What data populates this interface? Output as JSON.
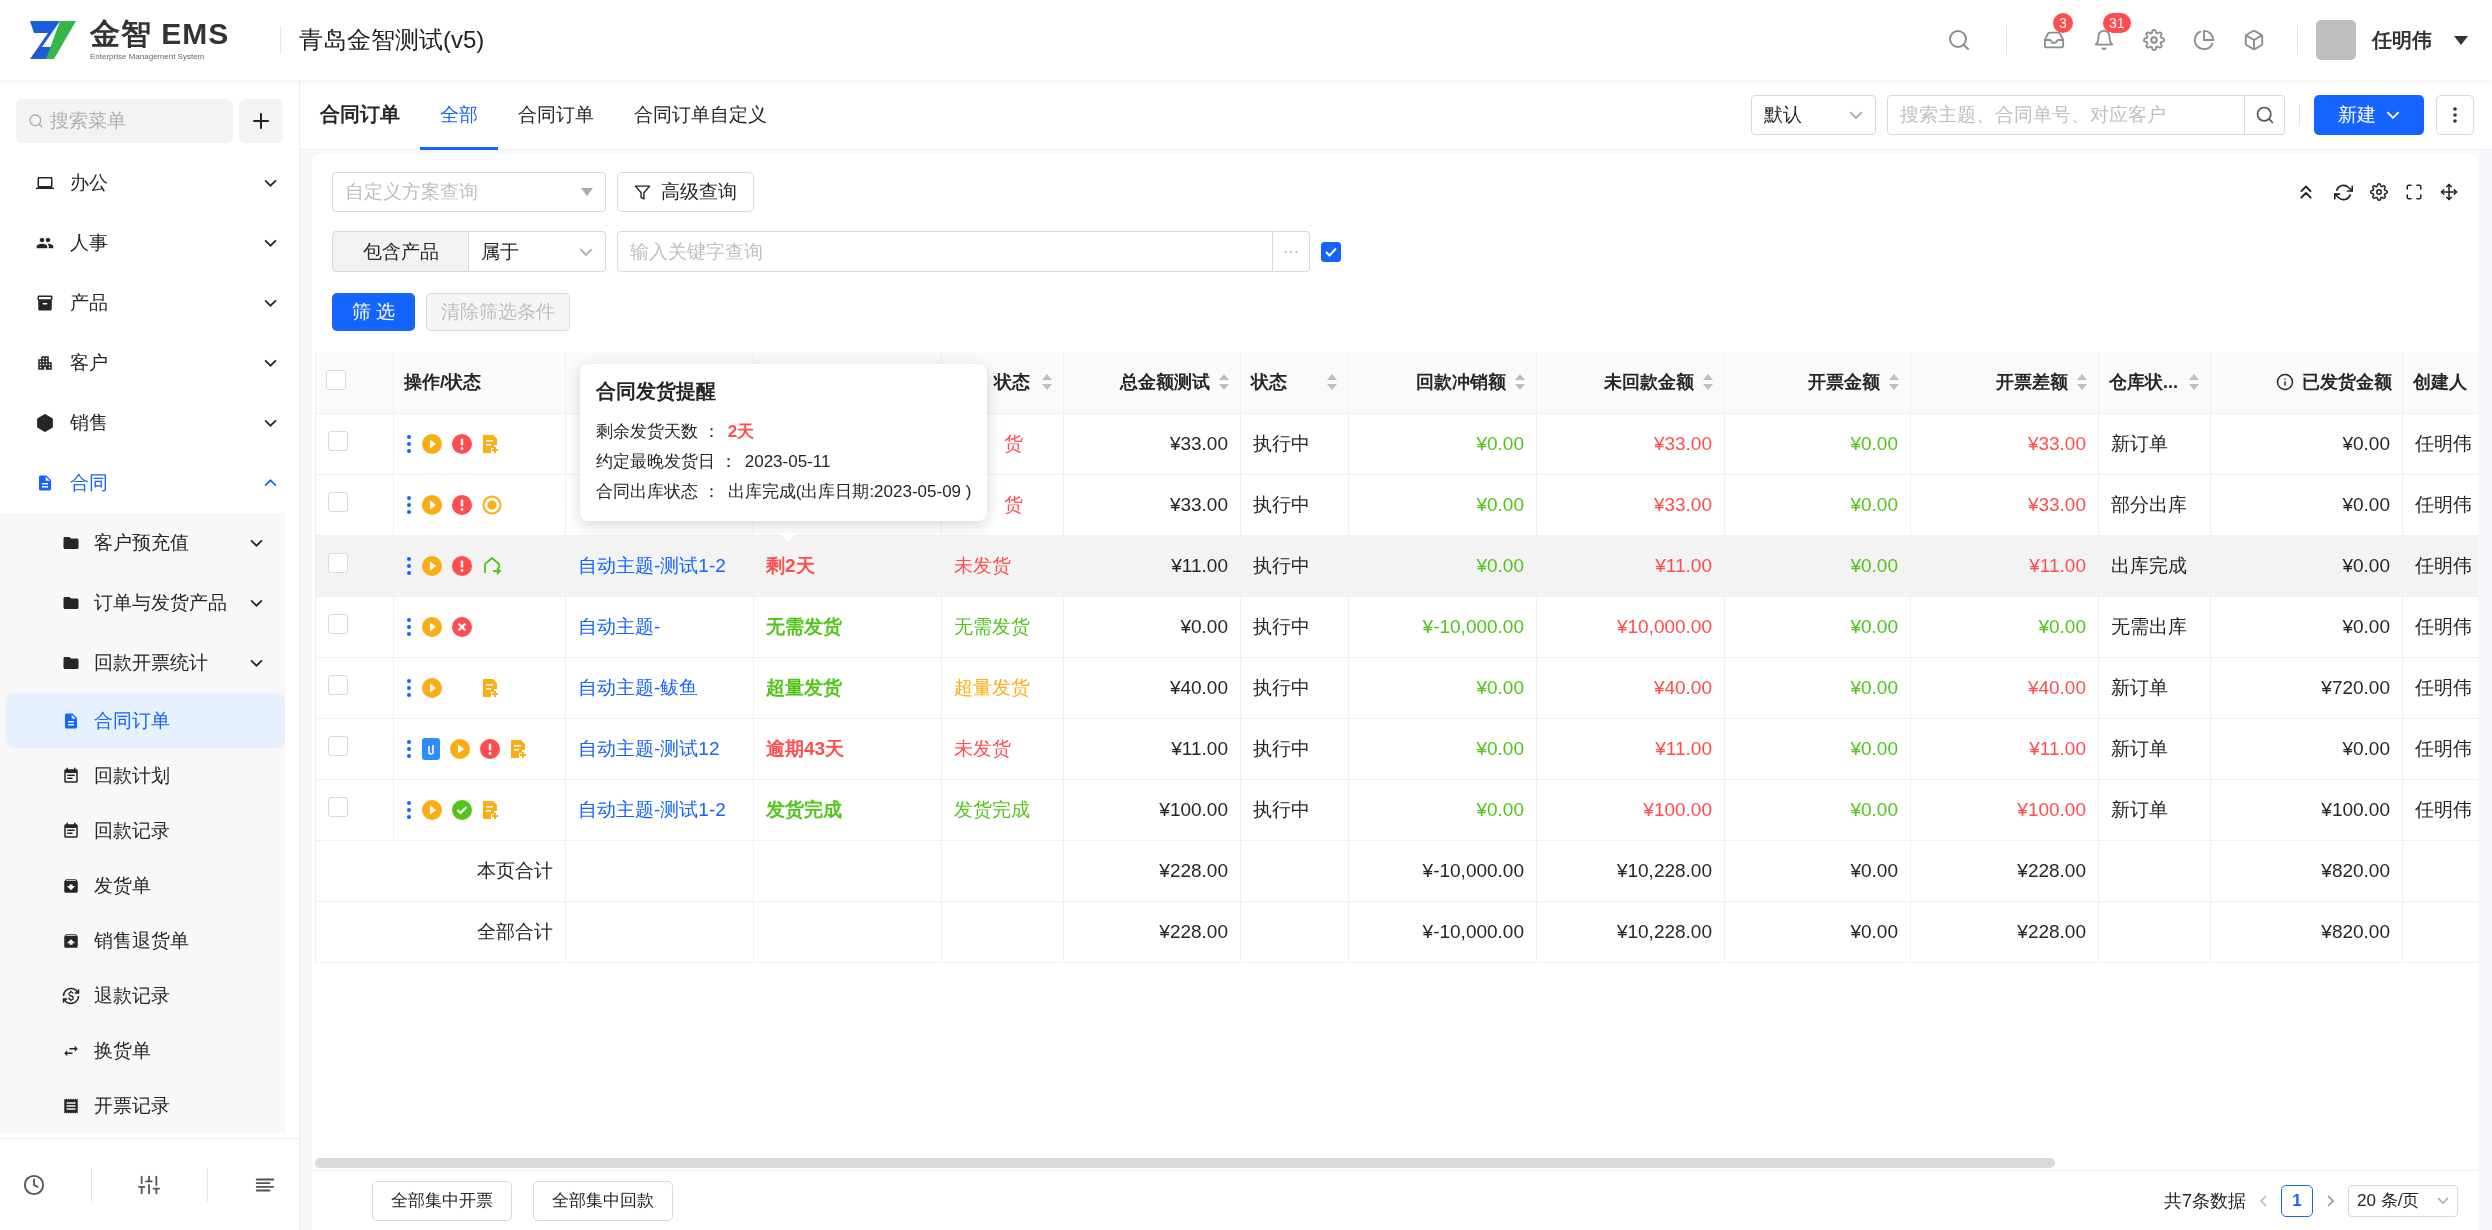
{
  "header": {
    "logo_text": "金智 EMS",
    "logo_subtitle": "Enterprise Management System",
    "company": "青岛金智测试(v5)",
    "notifications": [
      {
        "kind": "inbox",
        "badge": "3"
      },
      {
        "kind": "bell",
        "badge": "31"
      },
      {
        "kind": "settings"
      },
      {
        "kind": "chart"
      },
      {
        "kind": "cube"
      }
    ],
    "user": "任明伟"
  },
  "sidebar": {
    "search_placeholder": "搜索菜单",
    "items": [
      {
        "label": "办公",
        "expanded": false,
        "selected": false
      },
      {
        "label": "人事",
        "expanded": false,
        "selected": false
      },
      {
        "label": "产品",
        "expanded": false,
        "selected": false
      },
      {
        "label": "客户",
        "expanded": false,
        "selected": false
      },
      {
        "label": "销售",
        "expanded": false,
        "selected": false
      },
      {
        "label": "合同",
        "expanded": true,
        "selected": true,
        "children": [
          {
            "label": "客户预充值",
            "kind": "folder",
            "expanded": false,
            "selected": false
          },
          {
            "label": "订单与发货产品",
            "kind": "folder",
            "expanded": false,
            "selected": false
          },
          {
            "label": "回款开票统计",
            "kind": "folder",
            "expanded": false,
            "selected": false
          },
          {
            "label": "合同订单",
            "kind": "page",
            "selected": true
          },
          {
            "label": "回款计划",
            "kind": "page",
            "selected": false
          },
          {
            "label": "回款记录",
            "kind": "page",
            "selected": false
          },
          {
            "label": "发货单",
            "kind": "page",
            "selected": false
          },
          {
            "label": "销售退货单",
            "kind": "page",
            "selected": false
          },
          {
            "label": "退款记录",
            "kind": "page",
            "selected": false
          },
          {
            "label": "换货单",
            "kind": "page",
            "selected": false
          },
          {
            "label": "开票记录",
            "kind": "page",
            "selected": false
          }
        ]
      }
    ]
  },
  "tabbar": {
    "title": "合同订单",
    "tabs": [
      {
        "label": "全部",
        "selected": true
      },
      {
        "label": "合同订单",
        "selected": false
      },
      {
        "label": "合同订单自定义",
        "selected": false
      }
    ],
    "view_select": "默认",
    "search_placeholder": "搜索主题、合同单号、对应客户",
    "new_button": "新建"
  },
  "filter": {
    "scheme_placeholder": "自定义方案查询",
    "advanced_button": "高级查询",
    "field_label": "包含产品",
    "operator": "属于",
    "keyword_placeholder": "输入关键字查询",
    "more_button": "···",
    "include_checked": true,
    "apply_button": "筛 选",
    "clear_button": {
      "label": "清除筛选条件",
      "disabled": true
    }
  },
  "table": {
    "columns": [
      {
        "kind": "check",
        "checked": false
      },
      {
        "kind": "text",
        "label": "操作/状态",
        "sortable": false,
        "info": false
      },
      {
        "kind": "text"
      },
      {
        "kind": "text"
      },
      {
        "kind": "text",
        "label": "状态",
        "sortable": true,
        "info": false
      },
      {
        "kind": "money",
        "label": "总金额测试",
        "sortable": true,
        "info": false
      },
      {
        "kind": "text",
        "label": "状态",
        "sortable": true,
        "info": false
      },
      {
        "kind": "money",
        "label": "回款冲销额",
        "sortable": true,
        "info": false
      },
      {
        "kind": "money",
        "label": "未回款金额",
        "sortable": true,
        "info": false
      },
      {
        "kind": "money",
        "label": "开票金额",
        "sortable": true,
        "info": false
      },
      {
        "kind": "money",
        "label": "开票差额",
        "sortable": true,
        "info": false
      },
      {
        "kind": "text",
        "label": "仓库状...",
        "sortable": true,
        "info": false
      },
      {
        "kind": "money",
        "label": "已发货金额",
        "sortable": false,
        "info": true
      },
      {
        "kind": "text",
        "label": "创建人",
        "info": false
      }
    ],
    "rows": [
      {
        "checked": false,
        "highlighted": false,
        "actions": [
          {
            "kind": "more"
          },
          {
            "kind": "play"
          },
          {
            "kind": "alert"
          },
          {
            "kind": "doc"
          }
        ],
        "ship_status": {
          "text": "货",
          "color": "#ff4d4f"
        },
        "total": "¥33.00",
        "status": "执行中",
        "writeoff": {
          "text": "¥0.00",
          "color": "#52c41a"
        },
        "unpaid": {
          "text": "¥33.00",
          "color": "#ff4d4f"
        },
        "invoiced": {
          "text": "¥0.00",
          "color": "#52c41a"
        },
        "invoice_diff": {
          "text": "¥33.00",
          "color": "#ff4d4f"
        },
        "warehouse": "新订单",
        "shipped": "¥0.00",
        "creator": "任明伟"
      },
      {
        "checked": false,
        "highlighted": false,
        "actions": [
          {
            "kind": "more"
          },
          {
            "kind": "play"
          },
          {
            "kind": "alert"
          },
          {
            "kind": "coin"
          }
        ],
        "ship_status": {
          "text": "货",
          "color": "#ff4d4f"
        },
        "total": "¥33.00",
        "status": "执行中",
        "writeoff": {
          "text": "¥0.00",
          "color": "#52c41a"
        },
        "unpaid": {
          "text": "¥33.00",
          "color": "#ff4d4f"
        },
        "invoiced": {
          "text": "¥0.00",
          "color": "#52c41a"
        },
        "invoice_diff": {
          "text": "¥33.00",
          "color": "#ff4d4f"
        },
        "warehouse": "部分出库",
        "shipped": "¥0.00",
        "creator": "任明伟"
      },
      {
        "checked": false,
        "highlighted": true,
        "actions": [
          {
            "kind": "more"
          },
          {
            "kind": "play"
          },
          {
            "kind": "alert"
          },
          {
            "kind": "share"
          }
        ],
        "subject": "自动主题-测试1-2",
        "reminder": {
          "text": "剩2天",
          "color": "#ff4d4f"
        },
        "ship_status": {
          "text": "未发货",
          "color": "#ff4d4f"
        },
        "total": "¥11.00",
        "status": "执行中",
        "writeoff": {
          "text": "¥0.00",
          "color": "#52c41a"
        },
        "unpaid": {
          "text": "¥11.00",
          "color": "#ff4d4f"
        },
        "invoiced": {
          "text": "¥0.00",
          "color": "#52c41a"
        },
        "invoice_diff": {
          "text": "¥11.00",
          "color": "#ff4d4f"
        },
        "warehouse": "出库完成",
        "shipped": "¥0.00",
        "creator": "任明伟",
        "tooltip": {
          "title": "合同发货提醒",
          "lines": [
            {
              "label": "剩余发货天数 ：",
              "value": "2天",
              "color": "#ff4d4f"
            },
            {
              "label": "约定最晚发货日 ：",
              "value": "2023-05-11",
              "color": "#262626"
            },
            {
              "label": "合同出库状态 ：",
              "value": "出库完成(出库日期:2023-05-09 )",
              "color": "#262626"
            }
          ]
        }
      },
      {
        "checked": false,
        "highlighted": false,
        "actions": [
          {
            "kind": "more"
          },
          {
            "kind": "play"
          },
          {
            "kind": "cancel"
          }
        ],
        "subject": "自动主题-",
        "reminder": {
          "text": "无需发货",
          "color": "#52c41a"
        },
        "ship_status": {
          "text": "无需发货",
          "color": "#52c41a"
        },
        "total": "¥0.00",
        "status": "执行中",
        "writeoff": {
          "text": "¥-10,000.00",
          "color": "#52c41a"
        },
        "unpaid": {
          "text": "¥10,000.00",
          "color": "#ff4d4f"
        },
        "invoiced": {
          "text": "¥0.00",
          "color": "#52c41a"
        },
        "invoice_diff": {
          "text": "¥0.00",
          "color": "#52c41a"
        },
        "warehouse": "无需出库",
        "shipped": "¥0.00",
        "creator": "任明伟"
      },
      {
        "checked": false,
        "highlighted": false,
        "actions": [
          {
            "kind": "more"
          },
          {
            "kind": "play"
          },
          {
            "kind": "blank"
          },
          {
            "kind": "doc"
          }
        ],
        "subject": "自动主题-鲅鱼",
        "reminder": {
          "text": "超量发货",
          "color": "#52c41a"
        },
        "ship_status": {
          "text": "超量发货",
          "color": "#faad14"
        },
        "total": "¥40.00",
        "status": "执行中",
        "writeoff": {
          "text": "¥0.00",
          "color": "#52c41a"
        },
        "unpaid": {
          "text": "¥40.00",
          "color": "#ff4d4f"
        },
        "invoiced": {
          "text": "¥0.00",
          "color": "#52c41a"
        },
        "invoice_diff": {
          "text": "¥40.00",
          "color": "#ff4d4f"
        },
        "warehouse": "新订单",
        "shipped": "¥720.00",
        "creator": "任明伟"
      },
      {
        "checked": false,
        "highlighted": false,
        "actions": [
          {
            "kind": "more"
          },
          {
            "kind": "attachment"
          },
          {
            "kind": "play"
          },
          {
            "kind": "alert"
          },
          {
            "kind": "doc"
          }
        ],
        "subject": "自动主题-测试12",
        "reminder": {
          "text": "逾期43天",
          "color": "#ff4d4f"
        },
        "ship_status": {
          "text": "未发货",
          "color": "#ff4d4f"
        },
        "total": "¥11.00",
        "status": "执行中",
        "writeoff": {
          "text": "¥0.00",
          "color": "#52c41a"
        },
        "unpaid": {
          "text": "¥11.00",
          "color": "#ff4d4f"
        },
        "invoiced": {
          "text": "¥0.00",
          "color": "#52c41a"
        },
        "invoice_diff": {
          "text": "¥11.00",
          "color": "#ff4d4f"
        },
        "warehouse": "新订单",
        "shipped": "¥0.00",
        "creator": "任明伟"
      },
      {
        "checked": false,
        "highlighted": false,
        "actions": [
          {
            "kind": "more"
          },
          {
            "kind": "play"
          },
          {
            "kind": "check"
          },
          {
            "kind": "doc"
          }
        ],
        "subject": "自动主题-测试1-2",
        "reminder": {
          "text": "发货完成",
          "color": "#52c41a"
        },
        "ship_status": {
          "text": "发货完成",
          "color": "#52c41a"
        },
        "total": "¥100.00",
        "status": "执行中",
        "writeoff": {
          "text": "¥0.00",
          "color": "#52c41a"
        },
        "unpaid": {
          "text": "¥100.00",
          "color": "#ff4d4f"
        },
        "invoiced": {
          "text": "¥0.00",
          "color": "#52c41a"
        },
        "invoice_diff": {
          "text": "¥100.00",
          "color": "#ff4d4f"
        },
        "warehouse": "新订单",
        "shipped": "¥100.00",
        "creator": "任明伟"
      }
    ],
    "totals": [
      {
        "label": "本页合计",
        "total": "¥228.00",
        "writeoff": "¥-10,000.00",
        "unpaid": "¥10,228.00",
        "invoiced": "¥0.00",
        "invoice_diff": "¥228.00",
        "shipped": "¥820.00"
      },
      {
        "label": "全部合计",
        "total": "¥228.00",
        "writeoff": "¥-10,000.00",
        "unpaid": "¥10,228.00",
        "invoiced": "¥0.00",
        "invoice_diff": "¥228.00",
        "shipped": "¥820.00"
      }
    ]
  },
  "footer": {
    "buttons": [
      "全部集中开票",
      "全部集中回款"
    ],
    "total": "共7条数据",
    "pages": [
      {
        "label": "1",
        "selected": true
      }
    ],
    "page_size": "20 条/页"
  }
}
